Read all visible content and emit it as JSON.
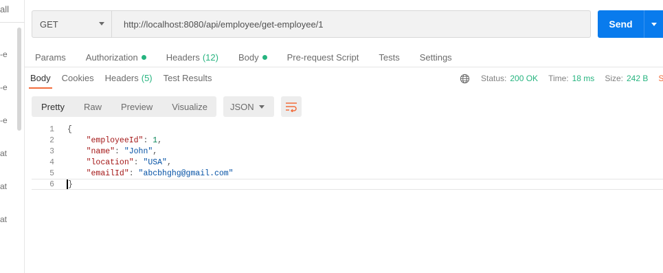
{
  "sidebar": {
    "all_label": "all",
    "fragments": [
      "-e",
      "-e",
      "-e",
      "at",
      "at",
      "at"
    ]
  },
  "request": {
    "method": "GET",
    "url": "http://localhost:8080/api/employee/get-employee/1",
    "send_label": "Send"
  },
  "request_tabs": {
    "params": "Params",
    "authorization": "Authorization",
    "headers": "Headers",
    "headers_count": "(12)",
    "body": "Body",
    "prerequest": "Pre-request Script",
    "tests": "Tests",
    "settings": "Settings"
  },
  "response_tabs": {
    "body": "Body",
    "cookies": "Cookies",
    "headers": "Headers",
    "headers_count": "(5)",
    "test_results": "Test Results"
  },
  "status_info": {
    "status_label": "Status:",
    "status_value": "200 OK",
    "time_label": "Time:",
    "time_value": "18 ms",
    "size_label": "Size:",
    "size_value": "242 B",
    "save_fragment": "Sa"
  },
  "view_modes": {
    "pretty": "Pretty",
    "raw": "Raw",
    "preview": "Preview",
    "visualize": "Visualize",
    "format": "JSON"
  },
  "response_body": {
    "line_numbers": [
      "1",
      "2",
      "3",
      "4",
      "5",
      "6"
    ],
    "open_brace": "{",
    "close_brace": "}",
    "fields": [
      {
        "key": "\"employeeId\"",
        "value": "1",
        "type": "num",
        "comma": ","
      },
      {
        "key": "\"name\"",
        "value": "\"John\"",
        "type": "str",
        "comma": ","
      },
      {
        "key": "\"location\"",
        "value": "\"USA\"",
        "type": "str",
        "comma": ","
      },
      {
        "key": "\"emailId\"",
        "value": "\"abcbhghg@gmail.com\"",
        "type": "str",
        "comma": ""
      }
    ]
  },
  "colors": {
    "accent_blue": "#097bed",
    "success_green": "#26b47f",
    "active_orange": "#f26b3a"
  }
}
